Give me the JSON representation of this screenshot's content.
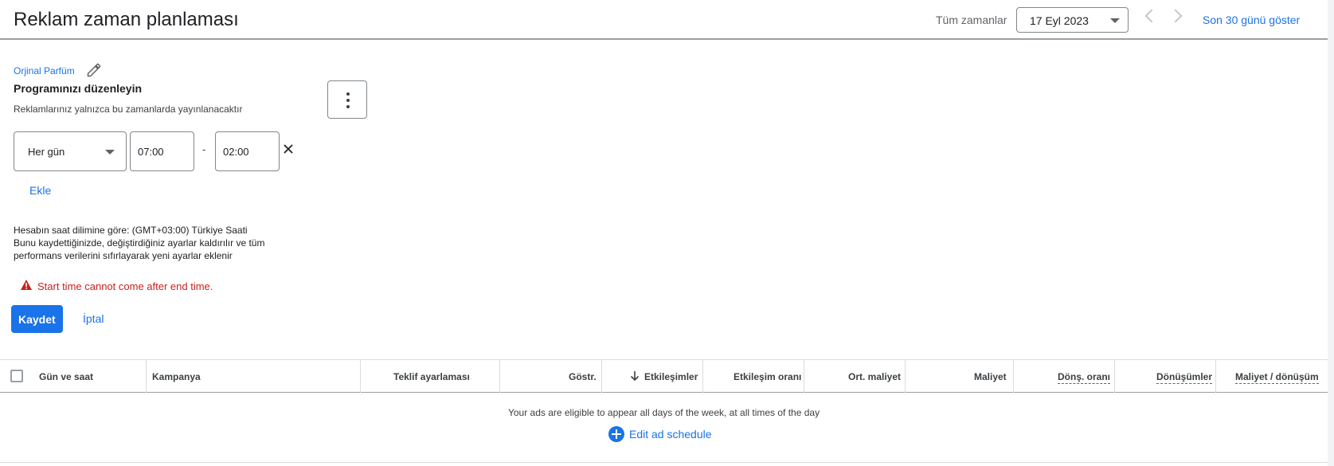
{
  "header": {
    "title": "Reklam zaman planlaması",
    "range_label": "Tüm zamanlar",
    "date_value": "17 Eyl 2023",
    "show_last_30": "Son 30 günü göster"
  },
  "editor": {
    "campaign_name": "Orjinal Parfüm",
    "title": "Programınızı düzenleyin",
    "subtitle": "Reklamlarınız yalnızca bu zamanlarda yayınlanacaktır",
    "day_value": "Her gün",
    "start_time": "07:00",
    "separator": "-",
    "end_time": "02:00",
    "add_label": "Ekle",
    "timezone_note": "Hesabın saat dilimine göre: (GMT+03:00) Türkiye Saati",
    "warning_line1": "Bunu kaydettiğinizde, değiştirdiğiniz ayarlar kaldırılır ve tüm",
    "warning_line2": "performans verilerini sıfırlayarak yeni ayarlar eklenir",
    "error_message": "Start time cannot come after end time.",
    "save_label": "Kaydet",
    "cancel_label": "İptal"
  },
  "table": {
    "columns": [
      "Gün ve saat",
      "Kampanya",
      "Teklif ayarlaması",
      "Göstr.",
      "Etkileşimler",
      "Etkileşim oranı",
      "Ort. maliyet",
      "Maliyet",
      "Dönş. oranı",
      "Dönüşümler",
      "Maliyet / dönüşüm"
    ],
    "sorted_column": "Etkileşimler",
    "sort_direction": "descending",
    "empty_message": "Your ads are eligible to appear all days of the week, at all times of the day",
    "edit_schedule_label": "Edit ad schedule"
  },
  "colors": {
    "accent": "#1a73e8",
    "error": "#c5221f",
    "text": "#202124",
    "border": "#dadce0"
  },
  "icons": [
    "pencil-icon",
    "more-vert-icon",
    "dropdown-caret-icon",
    "chevron-left-icon",
    "chevron-right-icon",
    "close-icon",
    "warning-icon",
    "arrow-down-icon",
    "add-circle-icon"
  ]
}
